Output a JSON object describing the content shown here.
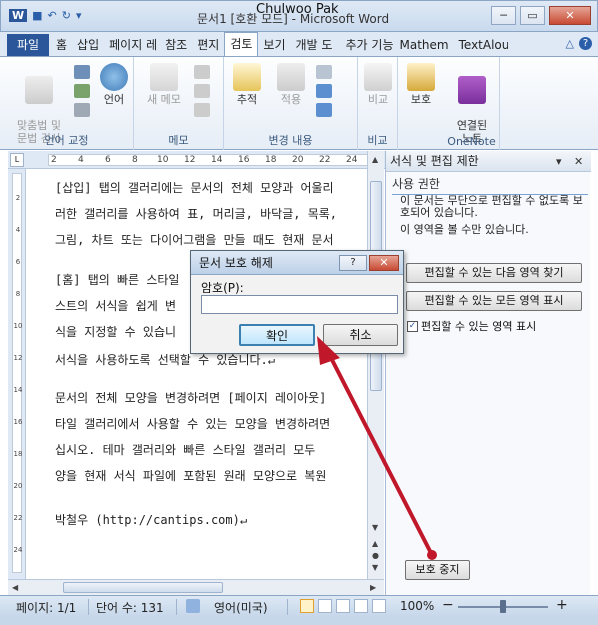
{
  "window": {
    "title": "문서1 [호환 모드] - Microsoft Word",
    "author_overlay": "Chulwoo Pak",
    "minimize": "─",
    "restore": "▭",
    "close": "✕"
  },
  "qat": {
    "word_icon": "W",
    "save": "■",
    "undo": "↶",
    "redo": "↻",
    "more": "▾"
  },
  "tabs": [
    {
      "label": "파일"
    },
    {
      "label": "홈"
    },
    {
      "label": "삽입"
    },
    {
      "label": "페이지 레"
    },
    {
      "label": "참조"
    },
    {
      "label": "편지"
    },
    {
      "label": "검토"
    },
    {
      "label": "보기"
    },
    {
      "label": "개발 도"
    },
    {
      "label": "추가 기능"
    },
    {
      "label": "Mathem"
    },
    {
      "label": "TextAlou"
    }
  ],
  "tab_right": {
    "collapse": "△",
    "help": "?"
  },
  "ribbon": {
    "groups": [
      {
        "label": "언어 교정"
      },
      {
        "label": "메모"
      },
      {
        "label": "변경 내용"
      },
      {
        "label": "비교"
      },
      {
        "label": "OneNote"
      }
    ],
    "buttons": {
      "spelling": "맞춤법 및\n문법 검사",
      "language": "언어",
      "new_comment": "새 메모",
      "track": "추적",
      "accept": "적용",
      "compare": "비교",
      "protect": "보호",
      "linked_notes": "연결된\n노트"
    }
  },
  "ruler": {
    "top_numbers": [
      "2",
      "4",
      "6",
      "8",
      "10",
      "12",
      "14",
      "16",
      "18",
      "20",
      "22",
      "24"
    ],
    "left_numbers": [
      "2",
      "4",
      "6",
      "8",
      "10",
      "12",
      "14",
      "16",
      "18",
      "20",
      "22",
      "24"
    ]
  },
  "document": {
    "lines": [
      "[삽입] 탭의 갤러리에는 문서의 전체 모양과 어울리",
      "러한 갤러리를 사용하여 표, 머리글, 바닥글, 목록,",
      "그림, 차트 또는 다이어그램을 만들 때도 현재 문서",
      "[홈] 탭의 빠른 스타일",
      "스트의 서식을 쉽게 변",
      "식을 지정할 수 있습니",
      "서식을 사용하도록 선택할 수 있습니다.↵",
      "문서의 전체 모양을 변경하려면 [페이지 레이아웃]",
      "타일 갤러리에서 사용할 수 있는 모양을 변경하려면",
      "십시오. 테마 갤러리와 빠른 스타일 갤러리 모두",
      "양을 현재 서식 파일에 포함된 원래 모양으로 복원",
      "박철우 (http://cantips.com)↵"
    ]
  },
  "pane": {
    "title": "서식 및 편집 제한",
    "dropdown": "▾",
    "close": "✕",
    "section": "사용 권한",
    "text1": "이 문서는 무단으로 편집할 수 없도록 보호되어 있습니다.",
    "text2": "이 영역을 볼 수만 있습니다.",
    "btn_next": "편집할 수 있는 다음 영역 찾기",
    "btn_all": "편집할 수 있는 모든 영역 표시",
    "checkbox_label": "편집할 수 있는 영역 표시",
    "checkbox_mark": "✓",
    "stop_button": "보호 중지"
  },
  "dialog": {
    "title": "문서 보호 해제",
    "help": "?",
    "close": "✕",
    "password_label": "암호(P):",
    "password_value": "",
    "ok": "확인",
    "cancel": "취소"
  },
  "statusbar": {
    "page": "페이지: 1/1",
    "words": "단어 수: 131",
    "language": "영어(미국)",
    "zoom": "100%",
    "zoom_out": "−",
    "zoom_in": "+"
  },
  "colors": {
    "accent": "#2b579a",
    "arrow": "#c0182a"
  }
}
